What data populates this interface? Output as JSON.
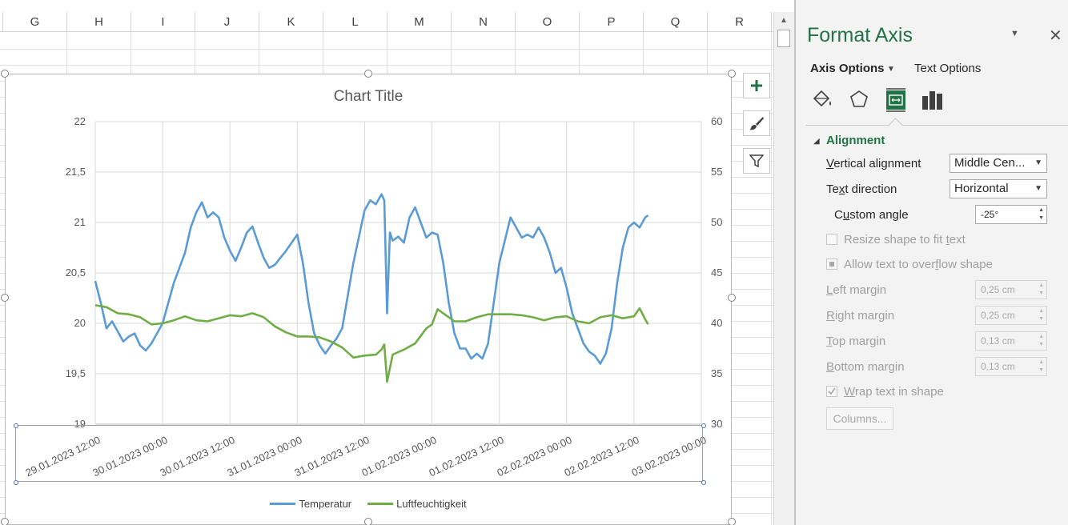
{
  "sheet": {
    "columns": [
      "G",
      "H",
      "I",
      "J",
      "K",
      "L",
      "M",
      "N",
      "O",
      "P",
      "Q",
      "R"
    ]
  },
  "chart": {
    "title": "Chart Title",
    "buttons": [
      "chart-elements",
      "chart-styles",
      "chart-filters"
    ]
  },
  "chart_data": {
    "type": "line",
    "title": "Chart Title",
    "xlabel": "",
    "ylabel": "",
    "x_tick_labels": [
      "29.01.2023 12:00",
      "30.01.2023 00:00",
      "30.01.2023 12:00",
      "31.01.2023 00:00",
      "31.01.2023 12:00",
      "01.02.2023 00:00",
      "01.02.2023 12:00",
      "02.02.2023 00:00",
      "02.02.2023 12:00",
      "03.02.2023 00:00"
    ],
    "x_tick_hours": [
      0,
      12,
      24,
      36,
      48,
      60,
      72,
      84,
      96,
      108
    ],
    "xlim": [
      "29.01.2023 12:00",
      "03.02.2023 00:00"
    ],
    "x_label_angle": -25,
    "y_left": {
      "ticks": [
        "19",
        "19,5",
        "20",
        "20,5",
        "21",
        "21,5",
        "22"
      ],
      "ylim": [
        19,
        22
      ]
    },
    "y_right": {
      "ticks": [
        "30",
        "35",
        "40",
        "45",
        "50",
        "55",
        "60"
      ],
      "ylim": [
        30,
        60
      ]
    },
    "grid": true,
    "legend_position": "bottom",
    "series": [
      {
        "name": "Temperatur",
        "axis": "left",
        "color": "#5b9bd5",
        "points": [
          [
            "29.01.2023 12:00",
            20.42
          ],
          [
            "29.01.2023 13:00",
            20.2
          ],
          [
            "29.01.2023 14:00",
            19.95
          ],
          [
            "29.01.2023 15:00",
            20.02
          ],
          [
            "29.01.2023 16:00",
            19.92
          ],
          [
            "29.01.2023 17:00",
            19.82
          ],
          [
            "29.01.2023 18:00",
            19.87
          ],
          [
            "29.01.2023 19:00",
            19.9
          ],
          [
            "29.01.2023 20:00",
            19.78
          ],
          [
            "29.01.2023 21:00",
            19.73
          ],
          [
            "29.01.2023 22:00",
            19.8
          ],
          [
            "30.01.2023 00:00",
            20.0
          ],
          [
            "30.01.2023 02:00",
            20.4
          ],
          [
            "30.01.2023 04:00",
            20.7
          ],
          [
            "30.01.2023 05:00",
            20.95
          ],
          [
            "30.01.2023 06:00",
            21.1
          ],
          [
            "30.01.2023 07:00",
            21.2
          ],
          [
            "30.01.2023 08:00",
            21.05
          ],
          [
            "30.01.2023 09:00",
            21.1
          ],
          [
            "30.01.2023 10:00",
            21.05
          ],
          [
            "30.01.2023 11:00",
            20.85
          ],
          [
            "30.01.2023 12:00",
            20.72
          ],
          [
            "30.01.2023 13:00",
            20.62
          ],
          [
            "30.01.2023 14:00",
            20.75
          ],
          [
            "30.01.2023 15:00",
            20.9
          ],
          [
            "30.01.2023 16:00",
            20.96
          ],
          [
            "30.01.2023 17:00",
            20.8
          ],
          [
            "30.01.2023 18:00",
            20.65
          ],
          [
            "30.01.2023 19:00",
            20.55
          ],
          [
            "30.01.2023 20:00",
            20.58
          ],
          [
            "30.01.2023 21:00",
            20.65
          ],
          [
            "30.01.2023 22:00",
            20.72
          ],
          [
            "30.01.2023 23:00",
            20.8
          ],
          [
            "31.01.2023 00:00",
            20.88
          ],
          [
            "31.01.2023 01:00",
            20.6
          ],
          [
            "31.01.2023 02:00",
            20.2
          ],
          [
            "31.01.2023 03:00",
            19.9
          ],
          [
            "31.01.2023 04:00",
            19.78
          ],
          [
            "31.01.2023 05:00",
            19.7
          ],
          [
            "31.01.2023 06:00",
            19.78
          ],
          [
            "31.01.2023 07:00",
            19.85
          ],
          [
            "31.01.2023 08:00",
            19.95
          ],
          [
            "31.01.2023 10:00",
            20.6
          ],
          [
            "31.01.2023 12:00",
            21.12
          ],
          [
            "31.01.2023 13:00",
            21.22
          ],
          [
            "31.01.2023 14:00",
            21.18
          ],
          [
            "31.01.2023 15:00",
            21.28
          ],
          [
            "31.01.2023 15:30",
            21.22
          ],
          [
            "31.01.2023 16:00",
            20.1
          ],
          [
            "31.01.2023 16:30",
            20.9
          ],
          [
            "31.01.2023 17:00",
            20.82
          ],
          [
            "31.01.2023 18:00",
            20.86
          ],
          [
            "31.01.2023 19:00",
            20.8
          ],
          [
            "31.01.2023 20:00",
            21.05
          ],
          [
            "31.01.2023 21:00",
            21.15
          ],
          [
            "31.01.2023 22:00",
            21.0
          ],
          [
            "31.01.2023 23:00",
            20.85
          ],
          [
            "01.02.2023 00:00",
            20.9
          ],
          [
            "01.02.2023 01:00",
            20.88
          ],
          [
            "01.02.2023 02:00",
            20.6
          ],
          [
            "01.02.2023 03:00",
            20.2
          ],
          [
            "01.02.2023 04:00",
            19.9
          ],
          [
            "01.02.2023 05:00",
            19.75
          ],
          [
            "01.02.2023 06:00",
            19.75
          ],
          [
            "01.02.2023 07:00",
            19.65
          ],
          [
            "01.02.2023 08:00",
            19.7
          ],
          [
            "01.02.2023 09:00",
            19.65
          ],
          [
            "01.02.2023 10:00",
            19.8
          ],
          [
            "01.02.2023 12:00",
            20.6
          ],
          [
            "01.02.2023 14:00",
            21.05
          ],
          [
            "01.02.2023 15:00",
            20.95
          ],
          [
            "01.02.2023 16:00",
            20.85
          ],
          [
            "01.02.2023 17:00",
            20.88
          ],
          [
            "01.02.2023 18:00",
            20.85
          ],
          [
            "01.02.2023 19:00",
            20.95
          ],
          [
            "01.02.2023 20:00",
            20.85
          ],
          [
            "01.02.2023 21:00",
            20.7
          ],
          [
            "01.02.2023 22:00",
            20.5
          ],
          [
            "01.02.2023 23:00",
            20.55
          ],
          [
            "02.02.2023 00:00",
            20.35
          ],
          [
            "02.02.2023 01:00",
            20.1
          ],
          [
            "02.02.2023 02:00",
            19.95
          ],
          [
            "02.02.2023 03:00",
            19.8
          ],
          [
            "02.02.2023 04:00",
            19.72
          ],
          [
            "02.02.2023 05:00",
            19.68
          ],
          [
            "02.02.2023 06:00",
            19.6
          ],
          [
            "02.02.2023 07:00",
            19.7
          ],
          [
            "02.02.2023 08:00",
            19.95
          ],
          [
            "02.02.2023 09:00",
            20.4
          ],
          [
            "02.02.2023 10:00",
            20.75
          ],
          [
            "02.02.2023 11:00",
            20.95
          ],
          [
            "02.02.2023 12:00",
            21.0
          ],
          [
            "02.02.2023 13:00",
            20.95
          ],
          [
            "02.02.2023 14:00",
            21.05
          ],
          [
            "02.02.2023 14:30",
            21.07
          ]
        ]
      },
      {
        "name": "Luftfeuchtigkeit",
        "axis": "right",
        "color": "#70ad47",
        "points": [
          [
            "29.01.2023 12:00",
            41.8
          ],
          [
            "29.01.2023 14:00",
            41.6
          ],
          [
            "29.01.2023 16:00",
            41.0
          ],
          [
            "29.01.2023 18:00",
            40.9
          ],
          [
            "29.01.2023 20:00",
            40.6
          ],
          [
            "29.01.2023 22:00",
            39.9
          ],
          [
            "30.01.2023 00:00",
            40.0
          ],
          [
            "30.01.2023 02:00",
            40.3
          ],
          [
            "30.01.2023 04:00",
            40.7
          ],
          [
            "30.01.2023 06:00",
            40.3
          ],
          [
            "30.01.2023 08:00",
            40.2
          ],
          [
            "30.01.2023 10:00",
            40.5
          ],
          [
            "30.01.2023 12:00",
            40.8
          ],
          [
            "30.01.2023 14:00",
            40.7
          ],
          [
            "30.01.2023 16:00",
            41.0
          ],
          [
            "30.01.2023 18:00",
            40.6
          ],
          [
            "30.01.2023 20:00",
            39.7
          ],
          [
            "30.01.2023 22:00",
            39.1
          ],
          [
            "31.01.2023 00:00",
            38.7
          ],
          [
            "31.01.2023 02:00",
            38.7
          ],
          [
            "31.01.2023 04:00",
            38.6
          ],
          [
            "31.01.2023 06:00",
            38.2
          ],
          [
            "31.01.2023 08:00",
            37.6
          ],
          [
            "31.01.2023 10:00",
            36.6
          ],
          [
            "31.01.2023 12:00",
            36.8
          ],
          [
            "31.01.2023 14:00",
            36.9
          ],
          [
            "31.01.2023 15:00",
            37.4
          ],
          [
            "31.01.2023 15:30",
            37.9
          ],
          [
            "31.01.2023 16:00",
            34.2
          ],
          [
            "31.01.2023 17:00",
            36.9
          ],
          [
            "31.01.2023 19:00",
            37.4
          ],
          [
            "31.01.2023 21:00",
            38.0
          ],
          [
            "31.01.2023 23:00",
            39.5
          ],
          [
            "01.02.2023 00:00",
            39.9
          ],
          [
            "01.02.2023 01:00",
            41.4
          ],
          [
            "01.02.2023 02:00",
            41.0
          ],
          [
            "01.02.2023 04:00",
            40.2
          ],
          [
            "01.02.2023 06:00",
            40.2
          ],
          [
            "01.02.2023 08:00",
            40.6
          ],
          [
            "01.02.2023 10:00",
            40.9
          ],
          [
            "01.02.2023 12:00",
            40.9
          ],
          [
            "01.02.2023 14:00",
            40.9
          ],
          [
            "01.02.2023 16:00",
            40.8
          ],
          [
            "01.02.2023 18:00",
            40.6
          ],
          [
            "01.02.2023 20:00",
            40.3
          ],
          [
            "01.02.2023 22:00",
            40.6
          ],
          [
            "02.02.2023 00:00",
            40.7
          ],
          [
            "02.02.2023 02:00",
            40.2
          ],
          [
            "02.02.2023 04:00",
            40.0
          ],
          [
            "02.02.2023 06:00",
            40.6
          ],
          [
            "02.02.2023 08:00",
            40.8
          ],
          [
            "02.02.2023 10:00",
            40.5
          ],
          [
            "02.02.2023 12:00",
            40.7
          ],
          [
            "02.02.2023 13:00",
            41.5
          ],
          [
            "02.02.2023 14:00",
            40.4
          ],
          [
            "02.02.2023 14:30",
            39.9
          ]
        ]
      }
    ]
  },
  "pane": {
    "title": "Format Axis",
    "menu_icon": "caret-down-icon",
    "close_icon": "close-icon",
    "tabs": {
      "axis_options": "Axis Options",
      "text_options": "Text Options"
    },
    "icons": [
      "fill-line-icon",
      "effects-pentagon-icon",
      "size-properties-icon",
      "axis-options-bars-icon"
    ],
    "section": "Alignment",
    "vertical_alignment": {
      "label": "Vertical alignment",
      "value": "Middle Cen..."
    },
    "text_direction": {
      "label": "Text direction",
      "value": "Horizontal"
    },
    "custom_angle": {
      "label": "Custom angle",
      "value": "-25°"
    },
    "resize_shape": "Resize shape to fit text",
    "allow_overflow": "Allow text to overflow shape",
    "left_margin": {
      "label": "Left margin",
      "value": "0,25 cm"
    },
    "right_margin": {
      "label": "Right margin",
      "value": "0,25 cm"
    },
    "top_margin": {
      "label": "Top margin",
      "value": "0,13 cm"
    },
    "bottom_margin": {
      "label": "Bottom margin",
      "value": "0,13 cm"
    },
    "wrap_text": "Wrap text in shape",
    "columns_button": "Columns..."
  }
}
